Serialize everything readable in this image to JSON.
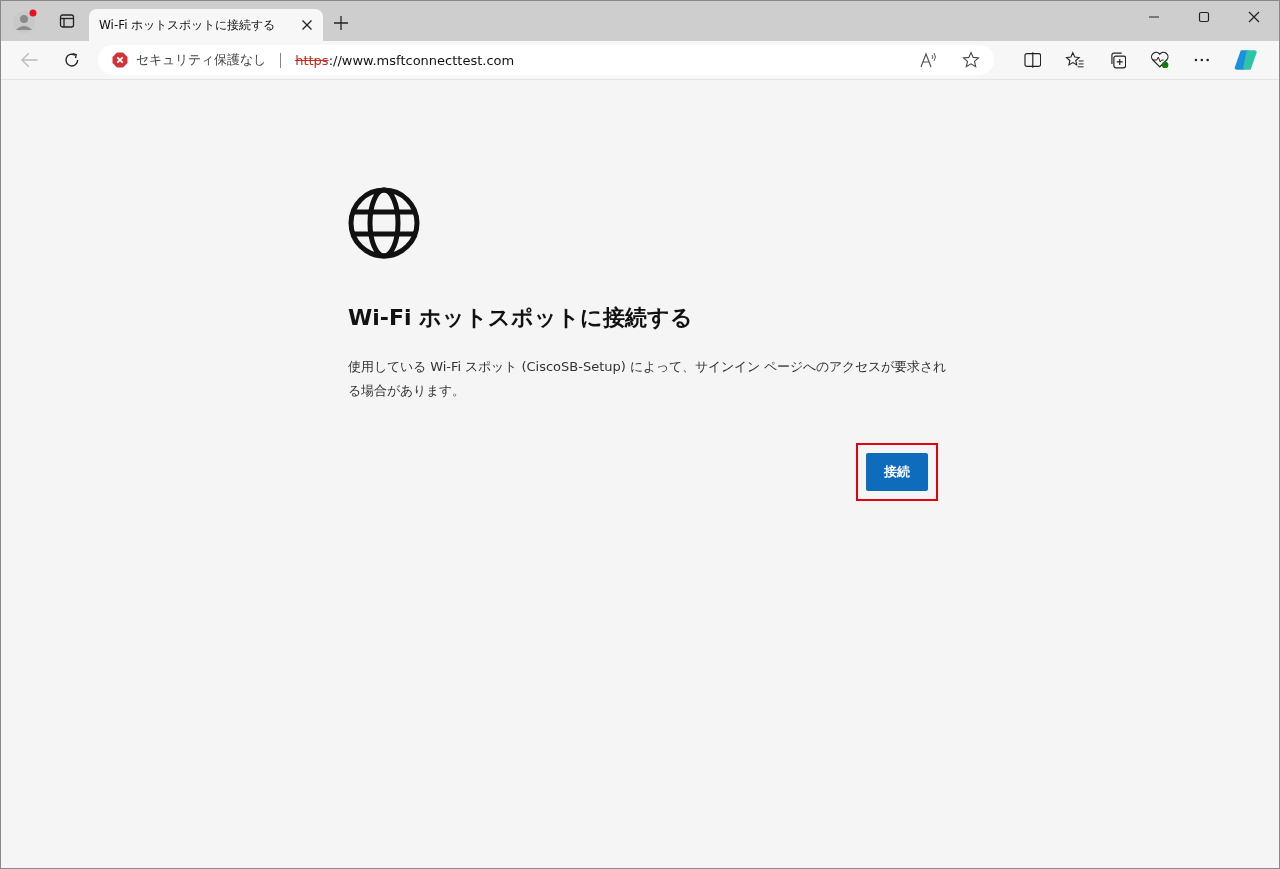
{
  "tabs": [
    {
      "title": "Wi-Fi ホットスポットに接続する",
      "selected": true
    }
  ],
  "profile": {
    "notification": true
  },
  "address_bar": {
    "security_label": "セキュリティ保護なし",
    "scheme": "https",
    "scheme_insecure": true,
    "rest": "://www.msftconnecttest.com"
  },
  "page": {
    "heading": "Wi-Fi ホットスポットに接続する",
    "body": "使用している Wi-Fi スポット (CiscoSB-Setup) によって、サインイン ページへのアクセスが要求される場合があります。",
    "button": {
      "label": "接続",
      "highlighted": true
    }
  }
}
